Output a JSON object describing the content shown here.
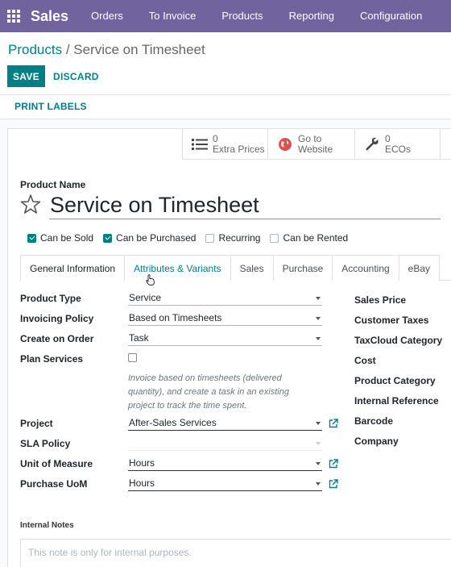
{
  "navbar": {
    "app_icon": "apps-grid-icon",
    "brand": "Sales",
    "menu": [
      "Orders",
      "To Invoice",
      "Products",
      "Reporting",
      "Configuration"
    ]
  },
  "breadcrumb": {
    "parent": "Products",
    "separator": " / ",
    "current": "Service on Timesheet"
  },
  "actions": {
    "save": "SAVE",
    "discard": "DISCARD"
  },
  "statusbar": {
    "print_labels": "PRINT LABELS"
  },
  "smart_buttons": [
    {
      "icon": "list-icon",
      "line1": "0",
      "line2": "Extra Prices"
    },
    {
      "icon": "globe-icon",
      "line1": "Go to",
      "line2": "Website"
    },
    {
      "icon": "wrench-icon",
      "line1": "0",
      "line2": "ECOs"
    }
  ],
  "product": {
    "name_label": "Product Name",
    "name": "Service on Timesheet",
    "favorite": false
  },
  "flags": [
    {
      "label": "Can be Sold",
      "checked": true
    },
    {
      "label": "Can be Purchased",
      "checked": true
    },
    {
      "label": "Recurring",
      "checked": false
    },
    {
      "label": "Can be Rented",
      "checked": false
    }
  ],
  "tabs": [
    "General Information",
    "Attributes & Variants",
    "Sales",
    "Purchase",
    "Accounting",
    "eBay"
  ],
  "active_tab": "General Information",
  "form": {
    "product_type": {
      "label": "Product Type",
      "value": "Service"
    },
    "invoicing_policy": {
      "label": "Invoicing Policy",
      "value": "Based on Timesheets"
    },
    "create_on_order": {
      "label": "Create on Order",
      "value": "Task"
    },
    "plan_services": {
      "label": "Plan Services",
      "checked": false
    },
    "help_text": "Invoice based on timesheets (delivered quantity), and create a task in an existing project to track the time spent.",
    "project": {
      "label": "Project",
      "value": "After-Sales Services"
    },
    "sla_policy": {
      "label": "SLA Policy",
      "value": ""
    },
    "uom": {
      "label": "Unit of Measure",
      "value": "Hours"
    },
    "purchase_uom": {
      "label": "Purchase UoM",
      "value": "Hours"
    }
  },
  "right_column": [
    "Sales Price",
    "Customer Taxes",
    "TaxCloud Category",
    "Cost",
    "Product Category",
    "Internal Reference",
    "Barcode",
    "Company"
  ],
  "notes": {
    "label": "Internal Notes",
    "placeholder": "This note is only for internal purposes."
  },
  "colors": {
    "navbar": "#71639e",
    "primary": "#017e84"
  }
}
